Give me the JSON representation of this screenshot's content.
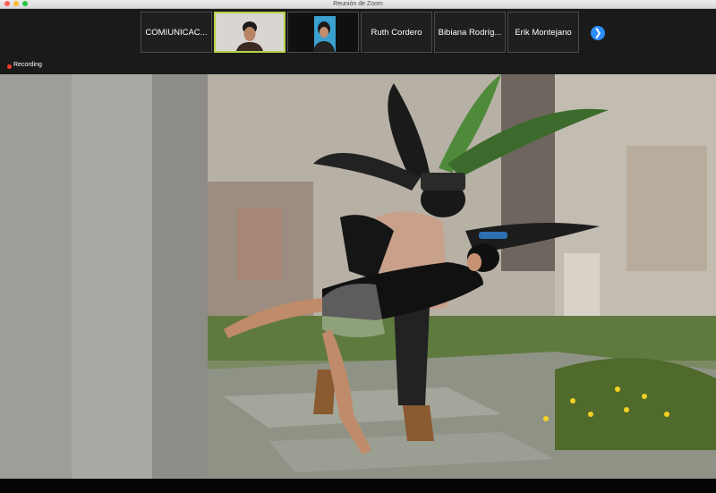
{
  "window": {
    "title": "Reunión de Zoom"
  },
  "participants": [
    {
      "name": "COMIUNICAC...",
      "has_video": false
    },
    {
      "name": "",
      "has_video": true,
      "active_speaker": true
    },
    {
      "name": "",
      "has_video": true,
      "active_speaker": false
    },
    {
      "name": "Ruth Cordero",
      "has_video": false
    },
    {
      "name": "Bibiana Rodríg...",
      "has_video": false
    },
    {
      "name": "Erik Montejano",
      "has_video": false
    }
  ],
  "navigation": {
    "next_icon": "chevron-right-icon"
  },
  "recording": {
    "label": "Recording",
    "color": "#ff3b30"
  },
  "colors": {
    "accent": "#2d8cff",
    "active_speaker_border": "#b6d24a"
  }
}
